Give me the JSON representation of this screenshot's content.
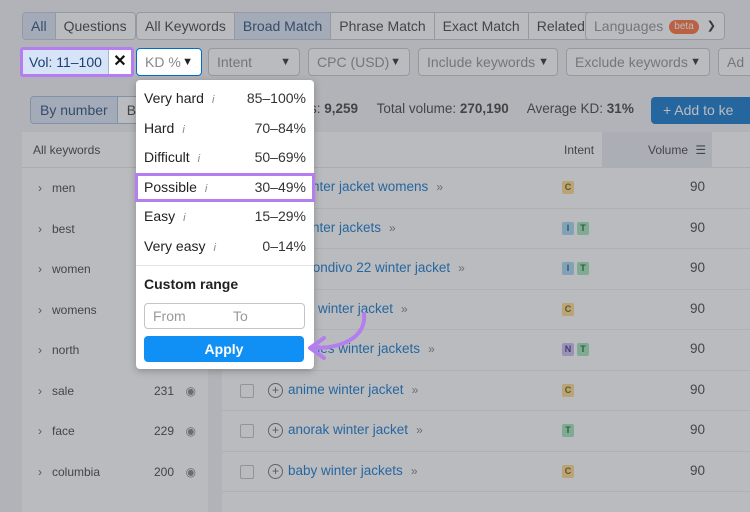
{
  "top_tabs": {
    "all": "All",
    "questions": "Questions"
  },
  "match_tabs": [
    "All Keywords",
    "Broad Match",
    "Phrase Match",
    "Exact Match",
    "Related"
  ],
  "languages": {
    "label": "Languages",
    "badge": "beta"
  },
  "filters": {
    "vol": "Vol: 11–100",
    "kd": "KD %",
    "intent": "Intent",
    "cpc": "CPC (USD)",
    "include": "Include keywords",
    "exclude": "Exclude keywords",
    "advanced": "Ad"
  },
  "group_toggle": {
    "by_number": "By number",
    "by_volume": "By"
  },
  "stats": {
    "keywords_label": "s:",
    "keywords_value": "9,259",
    "total_label": "Total volume:",
    "total_value": "270,190",
    "kd_label": "Average KD:",
    "kd_value": "31%"
  },
  "add_button": "+  Add to ke",
  "kd_menu": {
    "items": [
      {
        "label": "Very hard",
        "range": "85–100%"
      },
      {
        "label": "Hard",
        "range": "70–84%"
      },
      {
        "label": "Difficult",
        "range": "50–69%"
      },
      {
        "label": "Possible",
        "range": "30–49%"
      },
      {
        "label": "Easy",
        "range": "15–29%"
      },
      {
        "label": "Very easy",
        "range": "0–14%"
      }
    ],
    "custom_title": "Custom range",
    "from_placeholder": "From",
    "to_placeholder": "To",
    "apply": "Apply"
  },
  "sidebar": {
    "header": "All keywords",
    "items": [
      {
        "label": "men",
        "count": ""
      },
      {
        "label": "best",
        "count": ""
      },
      {
        "label": "women",
        "count": ""
      },
      {
        "label": "womens",
        "count": ""
      },
      {
        "label": "north",
        "count": ""
      },
      {
        "label": "sale",
        "count": "231"
      },
      {
        "label": "face",
        "count": "229"
      },
      {
        "label": "columbia",
        "count": "200"
      }
    ]
  },
  "table": {
    "intent_header": "Intent",
    "volume_header": "Volume",
    "rows": [
      {
        "keyword": "1 winter jacket womens",
        "tags": [
          "C"
        ],
        "volume": "90"
      },
      {
        "keyword": "1 winter jackets",
        "tags": [
          "I",
          "T"
        ],
        "volume": "90"
      },
      {
        "keyword": "as condivo 22 winter jacket",
        "tags": [
          "I",
          "T"
        ],
        "volume": "90"
      },
      {
        "keyword": "orce winter jacket",
        "tags": [
          "C"
        ],
        "volume": "90"
      },
      {
        "keyword": "n ladies winter jackets",
        "tags": [
          "N",
          "T"
        ],
        "volume": "90"
      },
      {
        "keyword": "anime winter jacket",
        "tags": [
          "C"
        ],
        "volume": "90"
      },
      {
        "keyword": "anorak winter jacket",
        "tags": [
          "T"
        ],
        "volume": "90"
      },
      {
        "keyword": "baby winter jackets",
        "tags": [
          "C"
        ],
        "volume": "90"
      }
    ]
  },
  "colors": {
    "highlight": "#b47ef0",
    "primary": "#006dca",
    "apply": "#1090f5"
  }
}
